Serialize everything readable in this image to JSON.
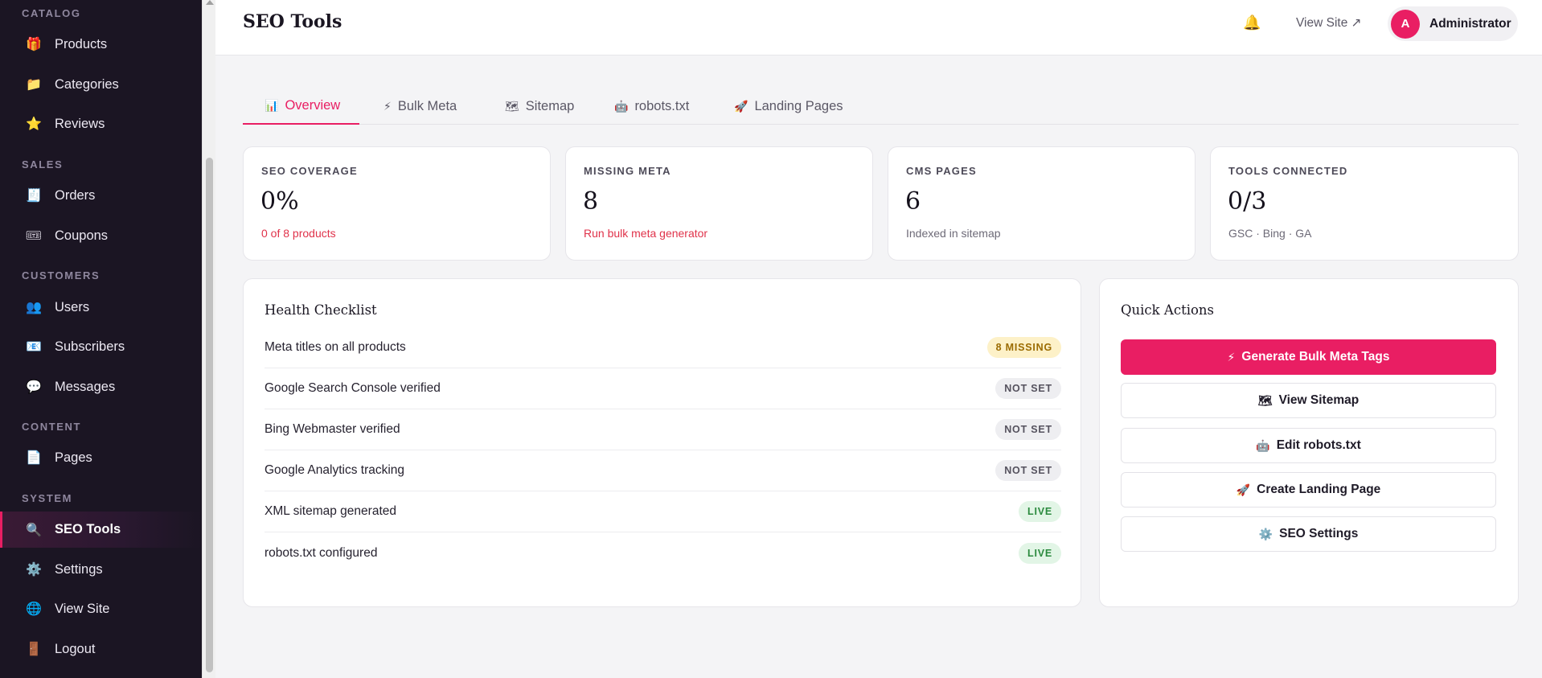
{
  "sidebar": {
    "sections": [
      {
        "label": "CATALOG"
      },
      {
        "label": "SALES"
      },
      {
        "label": "CUSTOMERS"
      },
      {
        "label": "CONTENT"
      },
      {
        "label": "SYSTEM"
      }
    ],
    "items": [
      {
        "label": "Products",
        "icon": "gift-icon",
        "glyph": "🎁"
      },
      {
        "label": "Categories",
        "icon": "folder-icon",
        "glyph": "📁"
      },
      {
        "label": "Reviews",
        "icon": "star-icon",
        "glyph": "⭐"
      },
      {
        "label": "Orders",
        "icon": "receipt-icon",
        "glyph": "🧾"
      },
      {
        "label": "Coupons",
        "icon": "ticket-icon",
        "glyph": "🎟"
      },
      {
        "label": "Users",
        "icon": "users-icon",
        "glyph": "👥"
      },
      {
        "label": "Subscribers",
        "icon": "envelope-icon",
        "glyph": "📧"
      },
      {
        "label": "Messages",
        "icon": "speech-bubble-icon",
        "glyph": "💬"
      },
      {
        "label": "Pages",
        "icon": "page-icon",
        "glyph": "📄"
      },
      {
        "label": "SEO Tools",
        "icon": "magnifier-icon",
        "glyph": "🔍",
        "active": true
      },
      {
        "label": "Settings",
        "icon": "gear-icon",
        "glyph": "⚙️"
      },
      {
        "label": "View Site",
        "icon": "globe-icon",
        "glyph": "🌐"
      },
      {
        "label": "Logout",
        "icon": "door-icon",
        "glyph": "🚪"
      }
    ]
  },
  "header": {
    "title": "SEO Tools",
    "bell_glyph": "🔔",
    "view_site": "View Site ↗",
    "user": {
      "initial": "A",
      "name": "Administrator"
    }
  },
  "tabs": [
    {
      "label": "Overview",
      "icon": "chart-icon",
      "glyph": "📊",
      "active": true
    },
    {
      "label": "Bulk Meta",
      "icon": "lightning-icon",
      "glyph": "⚡"
    },
    {
      "label": "Sitemap",
      "icon": "map-icon",
      "glyph": "🗺"
    },
    {
      "label": "robots.txt",
      "icon": "robot-icon",
      "glyph": "🤖"
    },
    {
      "label": "Landing Pages",
      "icon": "rocket-icon",
      "glyph": "🚀"
    }
  ],
  "stats": [
    {
      "label": "SEO COVERAGE",
      "value": "0%",
      "sub": "0 of 8 products",
      "sub_style": "warn"
    },
    {
      "label": "MISSING META",
      "value": "8",
      "sub": "Run bulk meta generator",
      "sub_style": "warn"
    },
    {
      "label": "CMS PAGES",
      "value": "6",
      "sub": "Indexed in sitemap",
      "sub_style": "muted"
    },
    {
      "label": "TOOLS CONNECTED",
      "value": "0/3",
      "sub": "GSC · Bing · GA",
      "sub_style": "muted"
    }
  ],
  "health": {
    "title": "Health Checklist",
    "rows": [
      {
        "label": "Meta titles on all products",
        "badge": "8 MISSING",
        "status": "missing"
      },
      {
        "label": "Google Search Console verified",
        "badge": "NOT SET",
        "status": "notset"
      },
      {
        "label": "Bing Webmaster verified",
        "badge": "NOT SET",
        "status": "notset"
      },
      {
        "label": "Google Analytics tracking",
        "badge": "NOT SET",
        "status": "notset"
      },
      {
        "label": "XML sitemap generated",
        "badge": "LIVE",
        "status": "live"
      },
      {
        "label": "robots.txt configured",
        "badge": "LIVE",
        "status": "live"
      }
    ]
  },
  "quick_actions": {
    "title": "Quick Actions",
    "buttons": [
      {
        "label": "Generate Bulk Meta Tags",
        "icon": "lightning-icon",
        "glyph": "⚡",
        "primary": true
      },
      {
        "label": "View Sitemap",
        "icon": "map-icon",
        "glyph": "🗺"
      },
      {
        "label": "Edit robots.txt",
        "icon": "robot-icon",
        "glyph": "🤖"
      },
      {
        "label": "Create Landing Page",
        "icon": "rocket-icon",
        "glyph": "🚀"
      },
      {
        "label": "SEO Settings",
        "icon": "gear-icon",
        "glyph": "⚙️"
      }
    ]
  },
  "colors": {
    "accent": "#e91e63",
    "sidebar_bg": "#1b1523",
    "page_bg": "#f4f4f6"
  }
}
